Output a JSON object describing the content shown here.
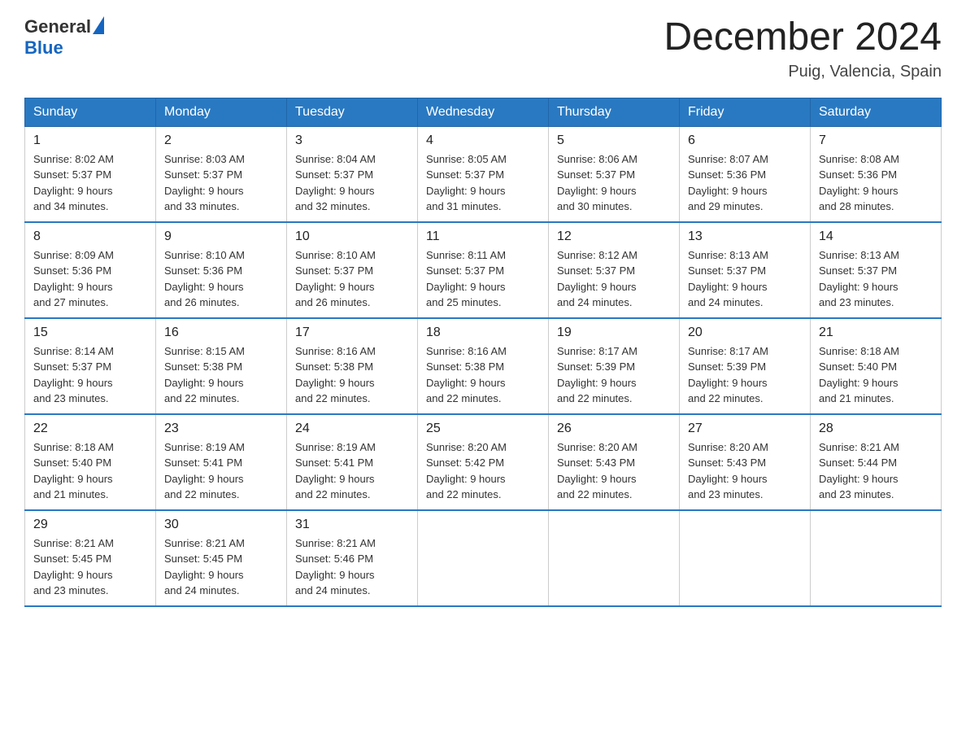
{
  "header": {
    "logo_general": "General",
    "logo_blue": "Blue",
    "month_title": "December 2024",
    "location": "Puig, Valencia, Spain"
  },
  "weekdays": [
    "Sunday",
    "Monday",
    "Tuesday",
    "Wednesday",
    "Thursday",
    "Friday",
    "Saturday"
  ],
  "weeks": [
    [
      {
        "day": "1",
        "sunrise": "8:02 AM",
        "sunset": "5:37 PM",
        "daylight": "9 hours and 34 minutes."
      },
      {
        "day": "2",
        "sunrise": "8:03 AM",
        "sunset": "5:37 PM",
        "daylight": "9 hours and 33 minutes."
      },
      {
        "day": "3",
        "sunrise": "8:04 AM",
        "sunset": "5:37 PM",
        "daylight": "9 hours and 32 minutes."
      },
      {
        "day": "4",
        "sunrise": "8:05 AM",
        "sunset": "5:37 PM",
        "daylight": "9 hours and 31 minutes."
      },
      {
        "day": "5",
        "sunrise": "8:06 AM",
        "sunset": "5:37 PM",
        "daylight": "9 hours and 30 minutes."
      },
      {
        "day": "6",
        "sunrise": "8:07 AM",
        "sunset": "5:36 PM",
        "daylight": "9 hours and 29 minutes."
      },
      {
        "day": "7",
        "sunrise": "8:08 AM",
        "sunset": "5:36 PM",
        "daylight": "9 hours and 28 minutes."
      }
    ],
    [
      {
        "day": "8",
        "sunrise": "8:09 AM",
        "sunset": "5:36 PM",
        "daylight": "9 hours and 27 minutes."
      },
      {
        "day": "9",
        "sunrise": "8:10 AM",
        "sunset": "5:36 PM",
        "daylight": "9 hours and 26 minutes."
      },
      {
        "day": "10",
        "sunrise": "8:10 AM",
        "sunset": "5:37 PM",
        "daylight": "9 hours and 26 minutes."
      },
      {
        "day": "11",
        "sunrise": "8:11 AM",
        "sunset": "5:37 PM",
        "daylight": "9 hours and 25 minutes."
      },
      {
        "day": "12",
        "sunrise": "8:12 AM",
        "sunset": "5:37 PM",
        "daylight": "9 hours and 24 minutes."
      },
      {
        "day": "13",
        "sunrise": "8:13 AM",
        "sunset": "5:37 PM",
        "daylight": "9 hours and 24 minutes."
      },
      {
        "day": "14",
        "sunrise": "8:13 AM",
        "sunset": "5:37 PM",
        "daylight": "9 hours and 23 minutes."
      }
    ],
    [
      {
        "day": "15",
        "sunrise": "8:14 AM",
        "sunset": "5:37 PM",
        "daylight": "9 hours and 23 minutes."
      },
      {
        "day": "16",
        "sunrise": "8:15 AM",
        "sunset": "5:38 PM",
        "daylight": "9 hours and 22 minutes."
      },
      {
        "day": "17",
        "sunrise": "8:16 AM",
        "sunset": "5:38 PM",
        "daylight": "9 hours and 22 minutes."
      },
      {
        "day": "18",
        "sunrise": "8:16 AM",
        "sunset": "5:38 PM",
        "daylight": "9 hours and 22 minutes."
      },
      {
        "day": "19",
        "sunrise": "8:17 AM",
        "sunset": "5:39 PM",
        "daylight": "9 hours and 22 minutes."
      },
      {
        "day": "20",
        "sunrise": "8:17 AM",
        "sunset": "5:39 PM",
        "daylight": "9 hours and 22 minutes."
      },
      {
        "day": "21",
        "sunrise": "8:18 AM",
        "sunset": "5:40 PM",
        "daylight": "9 hours and 21 minutes."
      }
    ],
    [
      {
        "day": "22",
        "sunrise": "8:18 AM",
        "sunset": "5:40 PM",
        "daylight": "9 hours and 21 minutes."
      },
      {
        "day": "23",
        "sunrise": "8:19 AM",
        "sunset": "5:41 PM",
        "daylight": "9 hours and 22 minutes."
      },
      {
        "day": "24",
        "sunrise": "8:19 AM",
        "sunset": "5:41 PM",
        "daylight": "9 hours and 22 minutes."
      },
      {
        "day": "25",
        "sunrise": "8:20 AM",
        "sunset": "5:42 PM",
        "daylight": "9 hours and 22 minutes."
      },
      {
        "day": "26",
        "sunrise": "8:20 AM",
        "sunset": "5:43 PM",
        "daylight": "9 hours and 22 minutes."
      },
      {
        "day": "27",
        "sunrise": "8:20 AM",
        "sunset": "5:43 PM",
        "daylight": "9 hours and 23 minutes."
      },
      {
        "day": "28",
        "sunrise": "8:21 AM",
        "sunset": "5:44 PM",
        "daylight": "9 hours and 23 minutes."
      }
    ],
    [
      {
        "day": "29",
        "sunrise": "8:21 AM",
        "sunset": "5:45 PM",
        "daylight": "9 hours and 23 minutes."
      },
      {
        "day": "30",
        "sunrise": "8:21 AM",
        "sunset": "5:45 PM",
        "daylight": "9 hours and 24 minutes."
      },
      {
        "day": "31",
        "sunrise": "8:21 AM",
        "sunset": "5:46 PM",
        "daylight": "9 hours and 24 minutes."
      },
      null,
      null,
      null,
      null
    ]
  ],
  "labels": {
    "sunrise": "Sunrise:",
    "sunset": "Sunset:",
    "daylight": "Daylight:"
  }
}
